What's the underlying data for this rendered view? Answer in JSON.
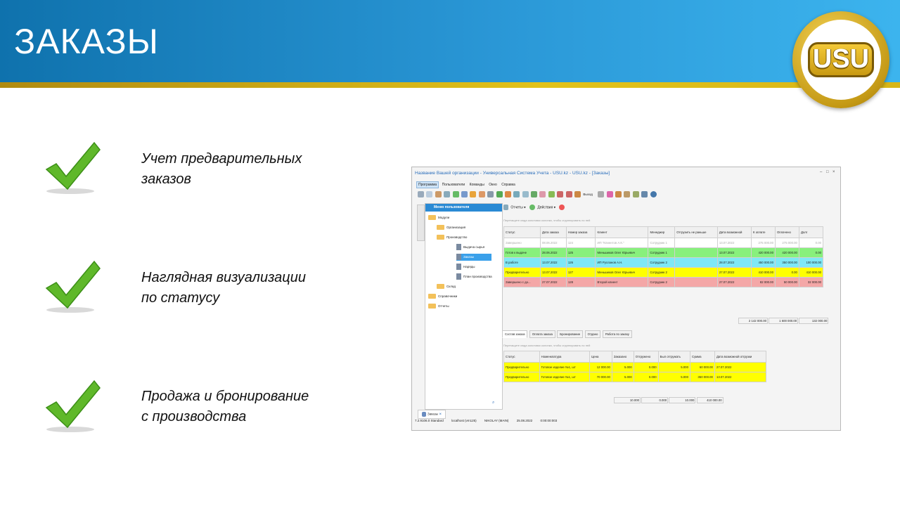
{
  "slide": {
    "title": "ЗАКАЗЫ",
    "logo_text": "USU",
    "features": [
      {
        "line1": "Учет предварительных",
        "line2": "заказов"
      },
      {
        "line1": "Наглядная визуализации",
        "line2": "по статусу"
      },
      {
        "line1": "Продажа и бронирование",
        "line2": "с производства"
      }
    ],
    "colors": {
      "header": "#1f85c6",
      "stripe": "#d8b618",
      "check": "#5fb82a"
    }
  },
  "window": {
    "title": "Название Вашей организации - Универсальная Система Учета - USU.kz - USU.kz - [Заказы]",
    "controls": [
      "–",
      "□",
      "×"
    ],
    "menu": [
      "Программа",
      "Пользователи",
      "Команды",
      "Окно",
      "Справка"
    ],
    "exit_label": "Выход",
    "subtoolbar": {
      "reports": "Отчеты",
      "actions": "Действия"
    },
    "sidebar_tab": "Пользовательское",
    "tree": {
      "header": "Меню пользователя",
      "items": [
        "Модули",
        "Организация",
        "Производство",
        "Выдача сырья",
        "Заказы",
        "Наряды",
        "План производства",
        "Склад",
        "Справочники",
        "Отчеты"
      ]
    },
    "group_hint": "Перетащите сюда заголовок колонки, чтобы сгруппировать по ней",
    "orders": {
      "columns": [
        "Статус",
        "Дата заказа",
        "Номер заказа",
        "Клиент",
        "Менеджер",
        "Отгрузить не раньше",
        "Дата возможной",
        "К оплате",
        "Оплачено",
        "Долг"
      ],
      "rows": [
        {
          "status": "Завершено",
          "date": "08.06.2022",
          "num": "124",
          "client": "ИП \"Клиентов А.К.\"",
          "manager": "Сотрудник 1",
          "ship": "",
          "possible": "13.07.2022",
          "topay": "275 000.00",
          "paid": "275 000.00",
          "debt": "0.00",
          "color": "#ffffff"
        },
        {
          "status": "Готов к выдаче",
          "date": "28.06.2022",
          "num": "125",
          "client": "Меньшиков Олег Юрьевич",
          "manager": "Сотрудник 1",
          "ship": "",
          "possible": "13.07.2022",
          "topay": "420 000.00",
          "paid": "420 000.00",
          "debt": "0.00",
          "color": "#88f07c"
        },
        {
          "status": "В работе",
          "date": "13.07.2022",
          "num": "126",
          "client": "ИП Русланов А.Н.",
          "manager": "Сотрудник 2",
          "ship": "",
          "possible": "28.07.2022",
          "topay": "450 000.00",
          "paid": "350 000.00",
          "debt": "100 000.00",
          "color": "#7fe8f6"
        },
        {
          "status": "Предварительно",
          "date": "13.07.2022",
          "num": "127",
          "client": "Меньшиков Олег Юрьевич",
          "manager": "Сотрудник 2",
          "ship": "",
          "possible": "27.07.2022",
          "topay": "410 000.00",
          "paid": "0.00",
          "debt": "410 000.00",
          "color": "#ffff00"
        },
        {
          "status": "Завершено с до...",
          "date": "27.07.2022",
          "num": "128",
          "client": "Второй клиент",
          "manager": "Сотрудник 2",
          "ship": "",
          "possible": "27.07.2022",
          "topay": "82 000.00",
          "paid": "50 000.00",
          "debt": "32 000.00",
          "color": "#f4a7a7"
        }
      ],
      "totals": [
        "2 142 000.00",
        "1 600 000.00",
        "132 000.00"
      ]
    },
    "tabs": [
      "Состав заказа",
      "Оплата заказа",
      "Бронирование",
      "Отдано",
      "Работа по заказу"
    ],
    "items": {
      "columns": [
        "Статус",
        "Номенклатура",
        "Цена",
        "Заказано",
        "Отгружено",
        "Был отгружать",
        "Сумма",
        "Дата возможной отгрузки"
      ],
      "rows": [
        {
          "status": "Предварительно",
          "name": "Готовое изделие №1, шт",
          "price": "12 000.00",
          "ordered": "5.000",
          "shipped": "0.000",
          "ship": "5.000",
          "sum": "60 000.00",
          "date": "27.07.2022",
          "color": "#ffff00"
        },
        {
          "status": "Предварительно",
          "name": "Готовое изделие №1, шт",
          "price": "70 000.00",
          "ordered": "5.000",
          "shipped": "0.000",
          "ship": "5.000",
          "sum": "350 000.00",
          "date": "13.07.2022",
          "color": "#ffff00"
        }
      ],
      "totals": [
        "10.000",
        "0.000",
        "10.000",
        "410 000.00"
      ]
    },
    "doc_tab": "Заказы",
    "status": {
      "version": "7.2.9106.0 Standard",
      "server": "localhost (vm125)",
      "user": "NIKOLAY (MAIN)",
      "date": "25.08.2022",
      "timer": "0:00:00:003"
    }
  }
}
